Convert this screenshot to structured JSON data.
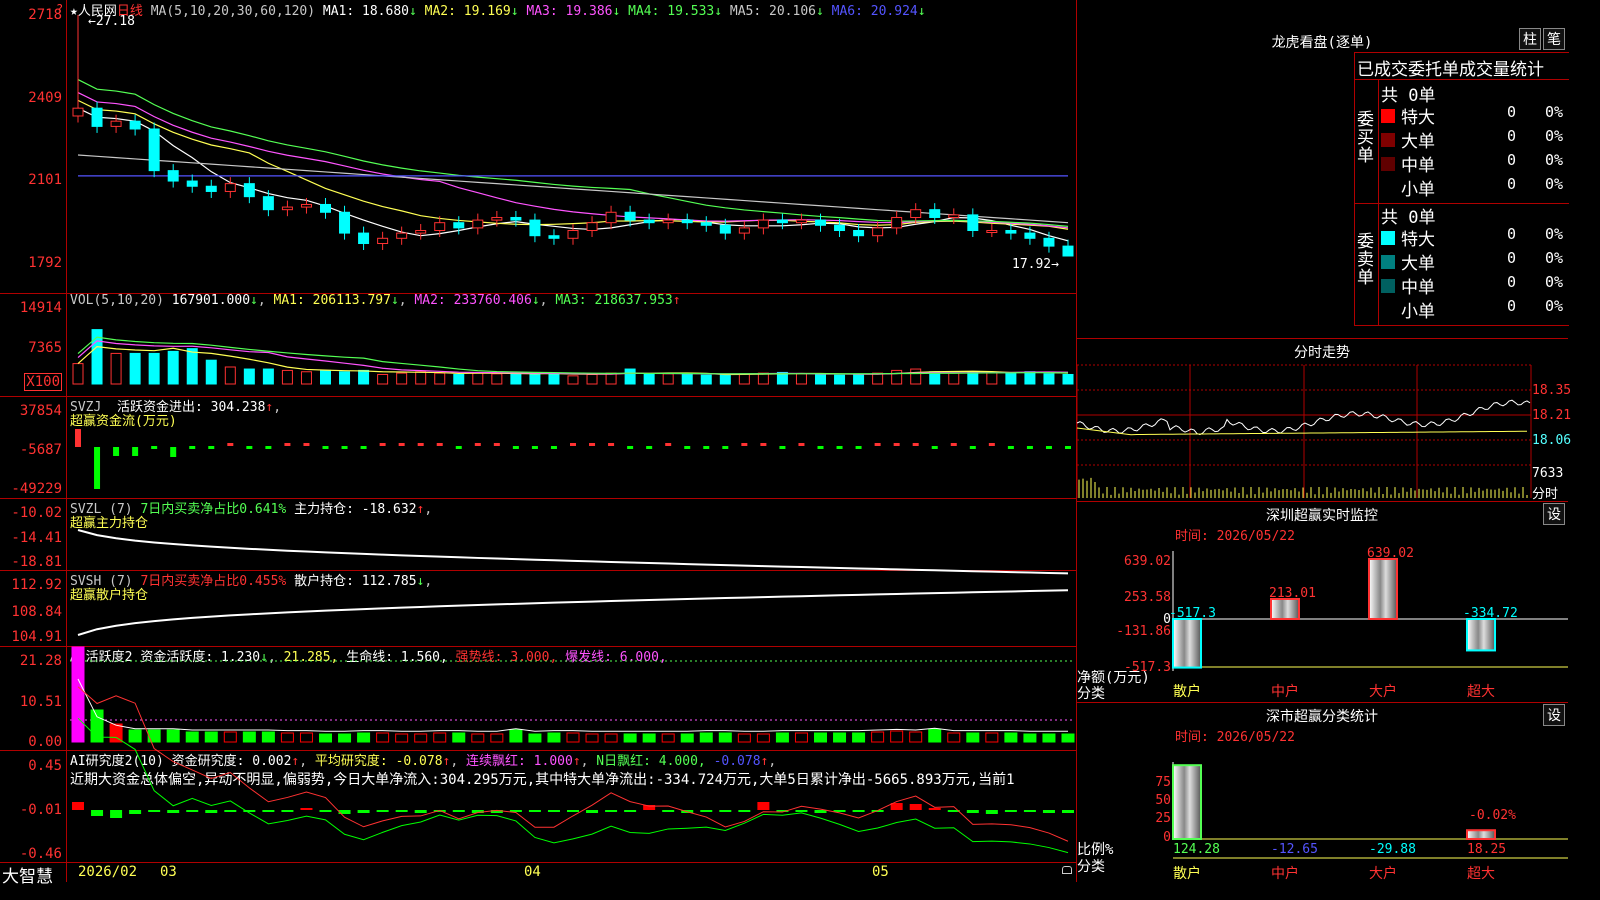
{
  "stock": {
    "name": "人民网",
    "period": "日线"
  },
  "main": {
    "ma_label": "MA(5,10,20,30,60,120)",
    "ma": [
      {
        "label": "MA1:",
        "value": "18.680",
        "arrow": "↓",
        "color": "#ffffff"
      },
      {
        "label": "MA2:",
        "value": "19.169",
        "arrow": "↓",
        "color": "#ffff54"
      },
      {
        "label": "MA3:",
        "value": "19.386",
        "arrow": "↓",
        "color": "#ff54ff"
      },
      {
        "label": "MA4:",
        "value": "19.533",
        "arrow": "↓",
        "color": "#54ff54"
      },
      {
        "label": "MA5:",
        "value": "20.106",
        "arrow": "↓",
        "color": "#c8c8c8"
      },
      {
        "label": "MA6:",
        "value": "20.924",
        "arrow": "↓",
        "color": "#5454ff"
      }
    ],
    "yticks": [
      "2718",
      "2409",
      "2101",
      "1792"
    ],
    "high_label": "27.18",
    "low_label": "17.92→"
  },
  "vol": {
    "title": "VOL(5,10,20)",
    "value": "167901.000",
    "ma1": "206113.797",
    "ma2": "233760.406",
    "ma3": "218637.953",
    "yticks": [
      "14914",
      "7365"
    ],
    "unit": "X100"
  },
  "svzj": {
    "title": "SVZJ",
    "desc": "活跃资金进出:",
    "value": "304.238",
    "sub": "超赢资金流(万元)",
    "yticks": [
      "37854",
      "-5687",
      "-49229"
    ]
  },
  "svzl": {
    "title": "SVZL (7)",
    "desc": "7日内买卖净占比0.641%",
    "desc2": "主力持仓:",
    "value": "-18.632",
    "sub": "超赢主力持仓",
    "yticks": [
      "-10.02",
      "-14.41",
      "-18.81"
    ]
  },
  "svsh": {
    "title": "SVSH (7)",
    "desc": "7日内买卖净占比0.455%",
    "desc2": "散户持仓:",
    "value": "112.785",
    "sub": "超赢散户持仓",
    "yticks": [
      "112.92",
      "108.84",
      "104.91"
    ]
  },
  "ai1": {
    "title": "AI活跃度2",
    "t1": "资金活跃度:",
    "v1": "1.230",
    "v2": "21.285,",
    "t3": "生命线:",
    "v3": "1.560,",
    "t4": "强势线:",
    "v4": "3.000,",
    "t5": "爆发线:",
    "v5": "6.000,",
    "yticks": [
      "21.28",
      "10.51",
      "0.00"
    ]
  },
  "ai2": {
    "title": "AI研究度2(10)",
    "t1": "资金研究度:",
    "v1": "0.002",
    "t2": "平均研究度:",
    "v2": "-0.078",
    "t3": "连续飘红:",
    "v3": "1.000",
    "t4": "N日飘红:",
    "v4": "4.000,",
    "v5": "-0.078",
    "desc": "近期大资金总体偏空,异动不明显,偏弱势,今日大单净流入:304.295万元,其中特大单净流出:-334.724万元,大单5日累计净出-5665.893万元,当前1",
    "yticks": [
      "0.45",
      "-0.01",
      "-0.46"
    ]
  },
  "xaxis": {
    "brand": "大智慧",
    "labels": [
      "2026/02",
      "03",
      "04",
      "05"
    ]
  },
  "lhb": {
    "title": "龙虎看盘(逐单)",
    "btn1": "柱",
    "btn2": "笔",
    "header": "已成交委托单成交量统计",
    "buy_group": "委买单",
    "sell_group": "委卖单",
    "buy_total": "共 0单",
    "sell_total": "共 0单",
    "buy_rows": [
      {
        "label": "特大",
        "count": "0",
        "pct": "0%",
        "color": "#ff0000"
      },
      {
        "label": "大单",
        "count": "0",
        "pct": "0%",
        "color": "#800000"
      },
      {
        "label": "中单",
        "count": "0",
        "pct": "0%",
        "color": "#600000"
      },
      {
        "label": "小单",
        "count": "0",
        "pct": "0%",
        "color": ""
      }
    ],
    "sell_rows": [
      {
        "label": "特大",
        "count": "0",
        "pct": "0%",
        "color": "#00ffff"
      },
      {
        "label": "大单",
        "count": "0",
        "pct": "0%",
        "color": "#008080"
      },
      {
        "label": "中单",
        "count": "0",
        "pct": "0%",
        "color": "#006060"
      },
      {
        "label": "小单",
        "count": "0",
        "pct": "0%",
        "color": ""
      }
    ]
  },
  "intraday": {
    "title": "分时走势",
    "yticks": [
      "18.35",
      "18.21",
      "18.06"
    ],
    "vol_tick": "7633",
    "xlabel": "分时"
  },
  "monitor": {
    "title": "深圳超赢实时监控",
    "btn": "设",
    "time": "时间: 2026/05/22",
    "yticks": [
      "639.02",
      "253.58",
      "0",
      "-131.86",
      "-517.3"
    ],
    "bars": [
      {
        "cat": "散户",
        "value": "-517.3"
      },
      {
        "cat": "中户",
        "value": "213.01"
      },
      {
        "cat": "大户",
        "value": "639.02"
      },
      {
        "cat": "超大",
        "value": "-334.72"
      }
    ],
    "ylabel": "净额(万元)",
    "xlabel": "分类"
  },
  "stats": {
    "title": "深市超赢分类统计",
    "btn": "设",
    "time": "时间: 2026/05/22",
    "yticks": [
      "75",
      "50",
      "25",
      "0"
    ],
    "bars": [
      {
        "cat": "散户",
        "value": "124.28"
      },
      {
        "cat": "中户",
        "value": "-12.65"
      },
      {
        "cat": "大户",
        "value": "-29.88"
      },
      {
        "cat": "超大",
        "value": "18.25"
      }
    ],
    "annot": "-0.02%",
    "ylabel": "比例%",
    "xlabel": "分类"
  },
  "chart_data": {
    "type": "candlestick",
    "yaxis_ticks": [
      "2718",
      "2409",
      "2101",
      "1792"
    ],
    "x_ticks": [
      "2026/02",
      "03",
      "04",
      "05"
    ],
    "high": 27.18,
    "low": 17.92,
    "close": [
      23.6,
      22.9,
      23.1,
      22.8,
      21.2,
      20.8,
      20.6,
      20.4,
      20.7,
      20.2,
      19.7,
      19.8,
      19.9,
      19.6,
      18.8,
      18.4,
      18.6,
      18.8,
      18.9,
      19.2,
      19.0,
      19.3,
      19.4,
      19.3,
      18.7,
      18.6,
      18.9,
      19.2,
      19.6,
      19.3,
      19.2,
      19.3,
      19.2,
      19.1,
      18.8,
      19.0,
      19.3,
      19.2,
      19.3,
      19.1,
      18.9,
      18.7,
      19.0,
      19.4,
      19.7,
      19.4,
      19.5,
      18.9,
      18.9,
      18.8,
      18.6,
      18.3,
      17.92
    ]
  }
}
